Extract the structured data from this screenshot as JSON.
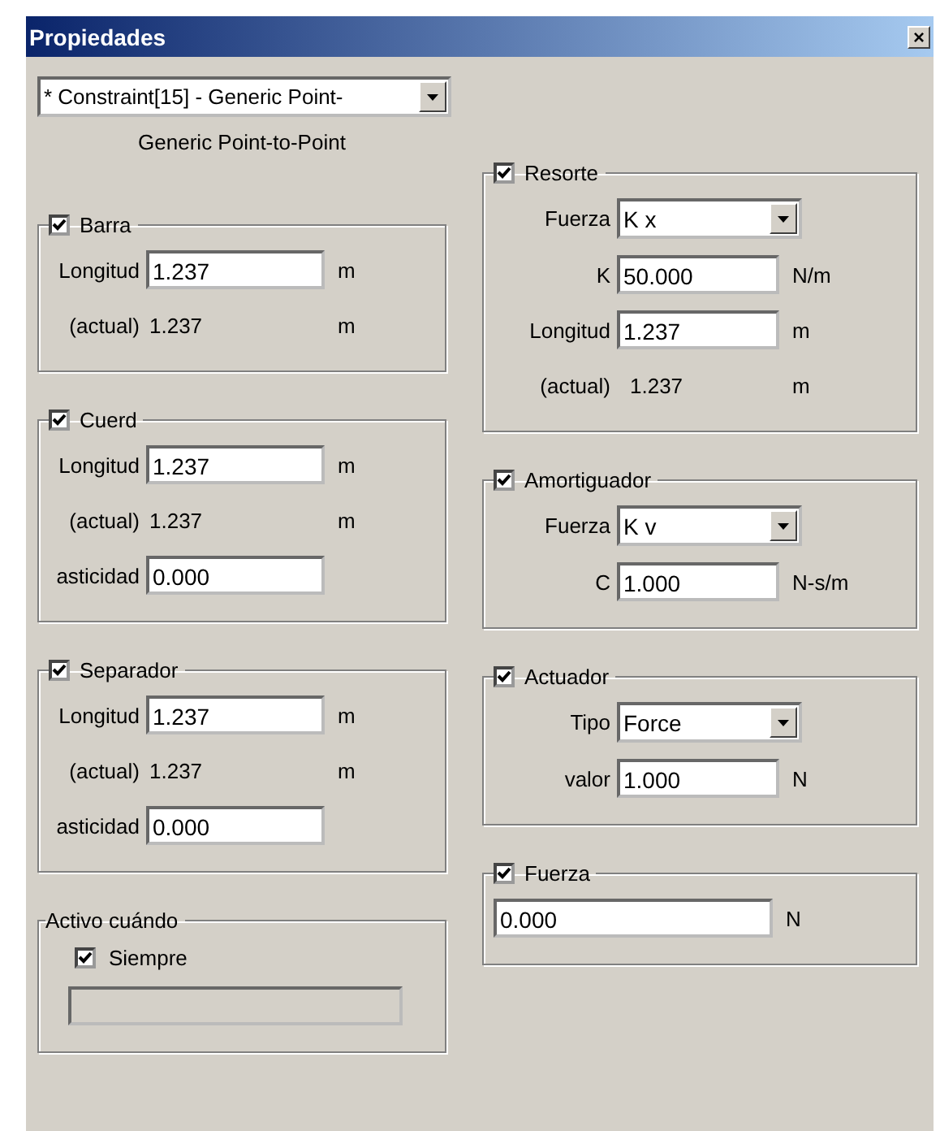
{
  "window": {
    "title": "Propiedades",
    "close": "×"
  },
  "selector": {
    "value": "* Constraint[15] - Generic Point-"
  },
  "subtitle": "Generic Point-to-Point",
  "left_groups": [
    {
      "kind": "check",
      "title": "Barra",
      "checked": true,
      "rows": [
        {
          "kind": "field",
          "label": "Longitud",
          "value": "1.237",
          "unit": "m"
        },
        {
          "kind": "reading",
          "label": "(actual)",
          "value": "1.237",
          "unit": "m"
        }
      ]
    },
    {
      "kind": "check",
      "title": "Cuerd",
      "checked": true,
      "rows": [
        {
          "kind": "field",
          "label": "Longitud",
          "value": "1.237",
          "unit": "m"
        },
        {
          "kind": "reading",
          "label": "(actual)",
          "value": "1.237",
          "unit": "m"
        },
        {
          "kind": "field",
          "label": "asticidad",
          "value": "0.000"
        }
      ]
    },
    {
      "kind": "check",
      "title": "Separador",
      "checked": true,
      "rows": [
        {
          "kind": "field",
          "label": "Longitud",
          "value": "1.237",
          "unit": "m"
        },
        {
          "kind": "reading",
          "label": "(actual)",
          "value": "1.237",
          "unit": "m"
        },
        {
          "kind": "field",
          "label": "asticidad",
          "value": "0.000"
        }
      ]
    },
    {
      "kind": "plain",
      "title": "Activo cuándo",
      "rows": [
        {
          "kind": "checkbox",
          "label": "Siempre",
          "checked": true
        },
        {
          "kind": "entry",
          "disabled": true
        }
      ]
    }
  ],
  "right_groups": [
    {
      "kind": "check",
      "title": "Resorte",
      "checked": true,
      "rows": [
        {
          "kind": "select",
          "label": "Fuerza",
          "value": "K x"
        },
        {
          "kind": "field",
          "label": "K",
          "value": "50.000",
          "unit": "N/m"
        },
        {
          "kind": "field",
          "label": "Longitud",
          "value": "1.237",
          "unit": "m"
        },
        {
          "kind": "reading",
          "label": "(actual)",
          "value": "1.237",
          "unit": "m"
        }
      ]
    },
    {
      "kind": "check",
      "title": "Amortiguador",
      "checked": true,
      "rows": [
        {
          "kind": "select",
          "label": "Fuerza",
          "value": "K v"
        },
        {
          "kind": "field",
          "label": "C",
          "value": "1.000",
          "unit": "N-s/m"
        }
      ]
    },
    {
      "kind": "check",
      "title": "Actuador",
      "checked": true,
      "rows": [
        {
          "kind": "select",
          "label": "Tipo",
          "value": "Force"
        },
        {
          "kind": "field",
          "label": "valor",
          "value": "1.000",
          "unit": "N"
        }
      ]
    },
    {
      "kind": "check",
      "title": "Fuerza",
      "checked": true,
      "rows": [
        {
          "kind": "bare",
          "value": "0.000",
          "unit": "N"
        }
      ]
    }
  ]
}
